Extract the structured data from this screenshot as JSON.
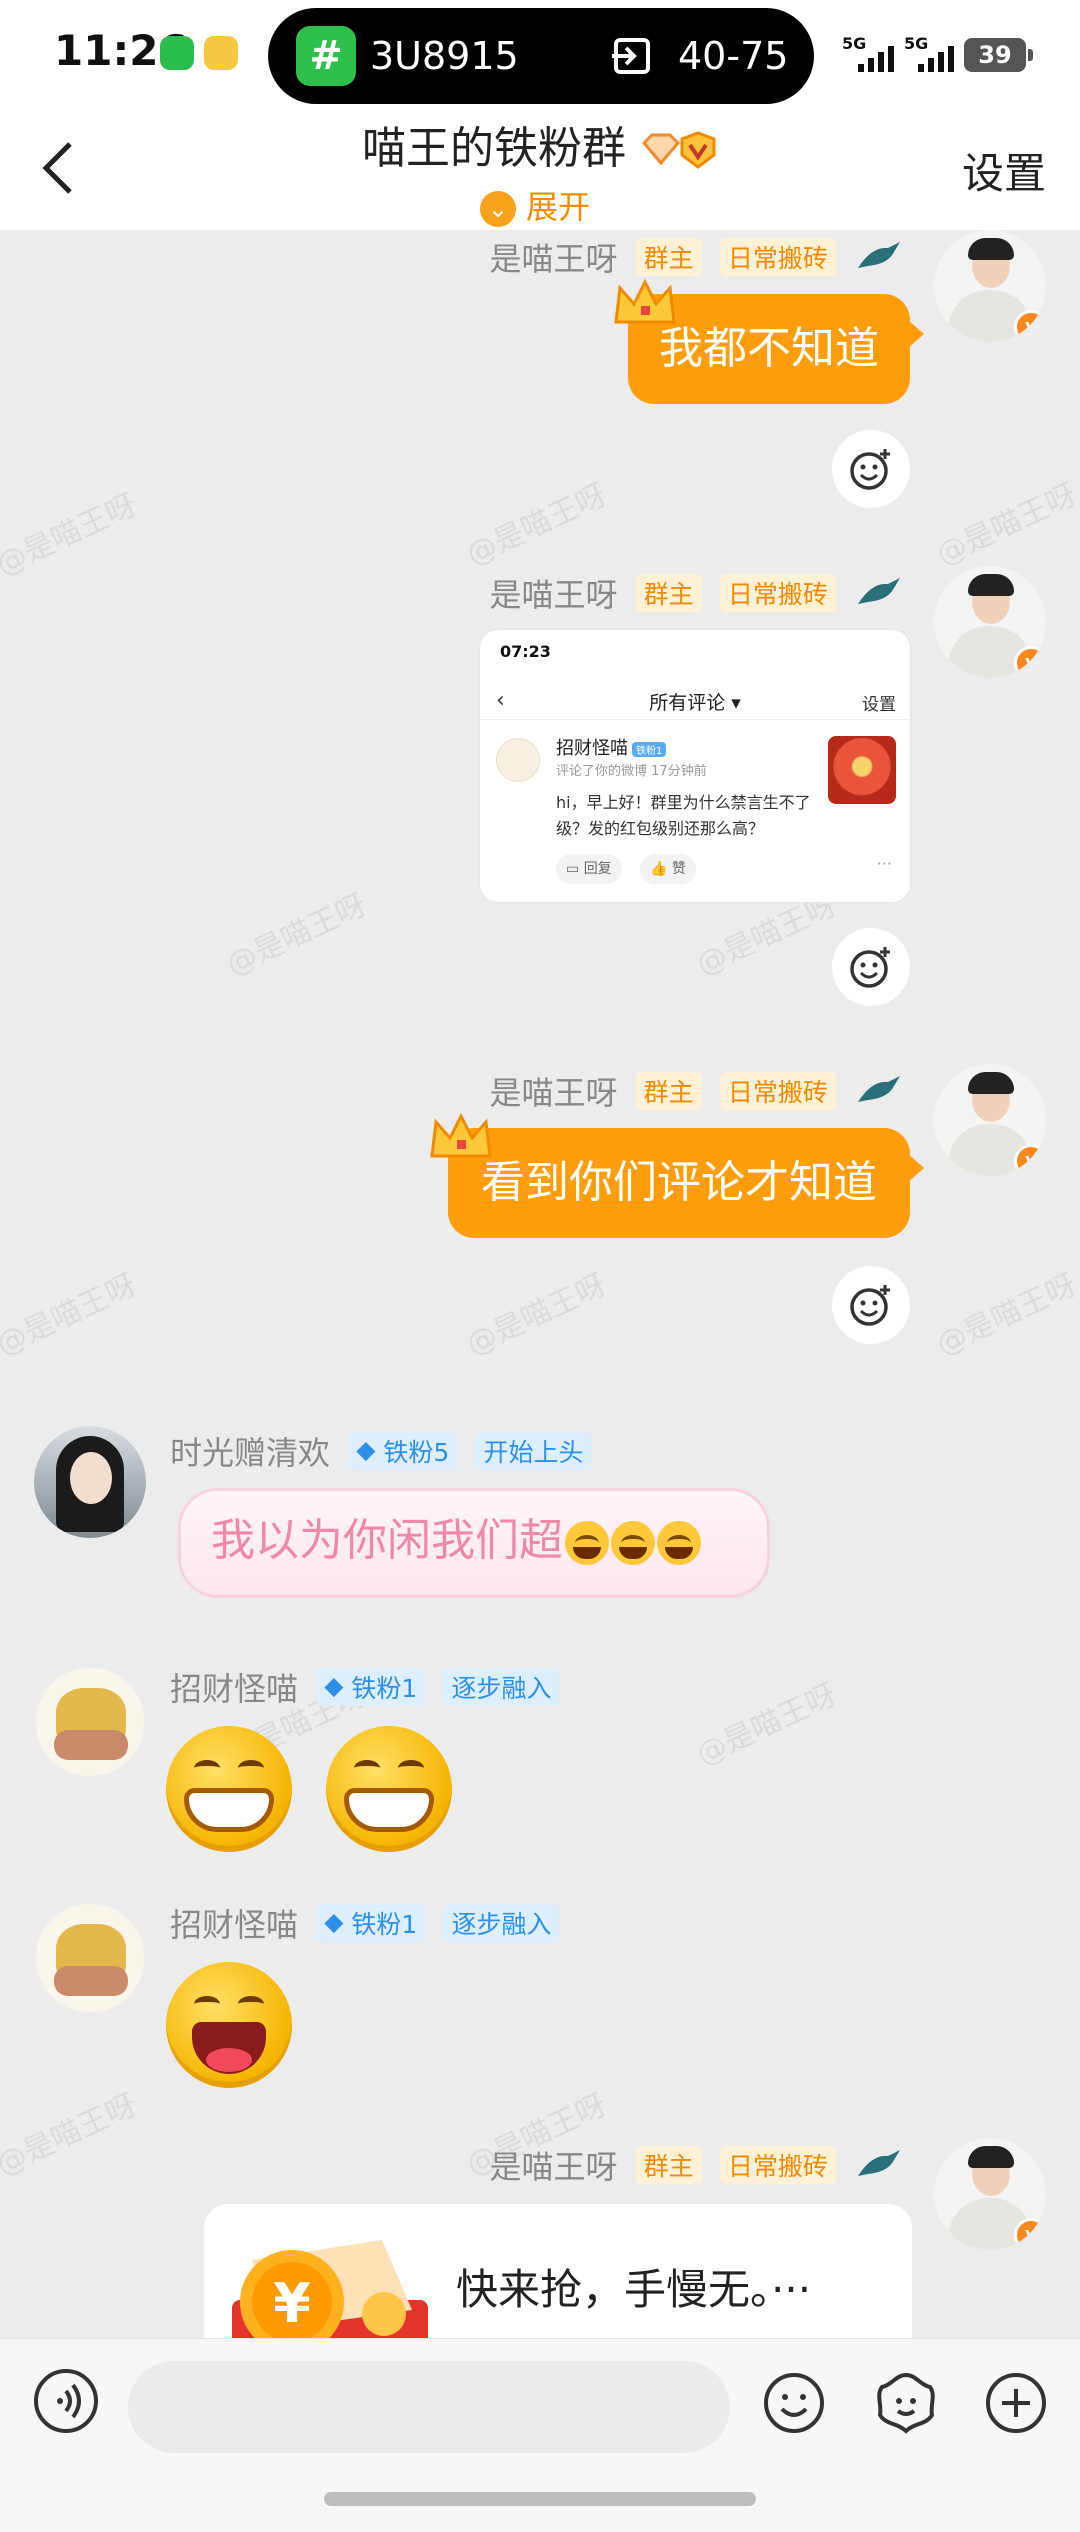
{
  "status_bar": {
    "time": "11:26",
    "flight_number": "3U8915",
    "gate": "40-75",
    "signal_1": "5G",
    "signal_2": "5G",
    "battery": "39"
  },
  "header": {
    "title": "喵王的铁粉群",
    "expand_label": "展开",
    "settings_label": "设置"
  },
  "watermark": "@是喵王呀",
  "messages": [
    {
      "sender": "是喵王呀",
      "badges": [
        "群主",
        "日常搬砖"
      ],
      "type": "text",
      "text": "我都不知道"
    },
    {
      "sender": "是喵王呀",
      "badges": [
        "群主",
        "日常搬砖"
      ],
      "type": "image",
      "screenshot": {
        "status_time": "07:23",
        "page_title": "所有评论",
        "settings": "设置",
        "commenter": "招财怪喵",
        "fan_tag": "铁粉1",
        "subtitle": "评论了你的微博",
        "time_ago": "17分钟前",
        "comment": "hi，早上好！群里为什么禁言生不了级？发的红包级别还那么高？",
        "reply": "回复",
        "like": "赞",
        "more": "···"
      }
    },
    {
      "sender": "是喵王呀",
      "badges": [
        "群主",
        "日常搬砖"
      ],
      "type": "text",
      "text": "看到你们评论才知道"
    },
    {
      "sender": "时光赠清欢",
      "badges": [
        "铁粉5",
        "开始上头"
      ],
      "type": "text",
      "text": "我以为你闲我们超"
    },
    {
      "sender": "招财怪喵",
      "badges": [
        "铁粉1",
        "逐步融入"
      ],
      "type": "emoji"
    },
    {
      "sender": "招财怪喵",
      "badges": [
        "铁粉1",
        "逐步融入"
      ],
      "type": "emoji"
    },
    {
      "sender": "是喵王呀",
      "badges": [
        "群主",
        "日常搬砖"
      ],
      "type": "red_packet",
      "text": "快来抢，手慢无。···"
    }
  ],
  "input": {
    "placeholder": ""
  },
  "icons": {
    "voice": "voice-icon",
    "emoji": "emoji-icon",
    "sticker": "sticker-icon",
    "add": "plus-icon"
  },
  "colors": {
    "accent": "#ff9d0a",
    "owner_tag_text": "#f08a00",
    "fan_tag_text": "#2f8fe8",
    "pink_text": "#ef89a7"
  }
}
